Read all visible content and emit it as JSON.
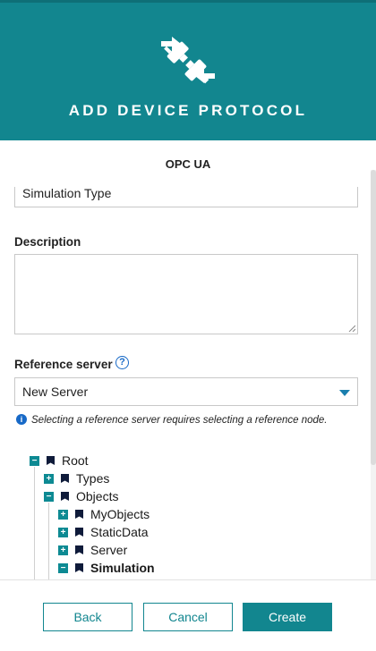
{
  "header": {
    "title": "ADD DEVICE PROTOCOL",
    "icon": "plug-connect-icon"
  },
  "subheader": {
    "title": "OPC UA"
  },
  "form": {
    "simulation_type_value": "Simulation Type",
    "description_label": "Description",
    "description_value": "",
    "reference_server_label": "Reference server",
    "reference_server_help": "?",
    "reference_server_value": "New Server",
    "info_glyph": "i",
    "info_text": "Selecting a reference server requires selecting a reference node."
  },
  "tree": {
    "nodes": [
      {
        "label": "Root",
        "toggle": "−",
        "bold": false
      },
      {
        "label": "Types",
        "toggle": "+",
        "bold": false
      },
      {
        "label": "Objects",
        "toggle": "−",
        "bold": false
      },
      {
        "label": "MyObjects",
        "toggle": "+",
        "bold": false
      },
      {
        "label": "StaticData",
        "toggle": "+",
        "bold": false
      },
      {
        "label": "Server",
        "toggle": "+",
        "bold": false
      },
      {
        "label": "Simulation",
        "toggle": "−",
        "bold": true
      }
    ]
  },
  "footer": {
    "back_label": "Back",
    "cancel_label": "Cancel",
    "create_label": "Create"
  },
  "colors": {
    "accent": "#12868f",
    "link": "#1769c7",
    "tree_node": "#0f1b3a"
  }
}
